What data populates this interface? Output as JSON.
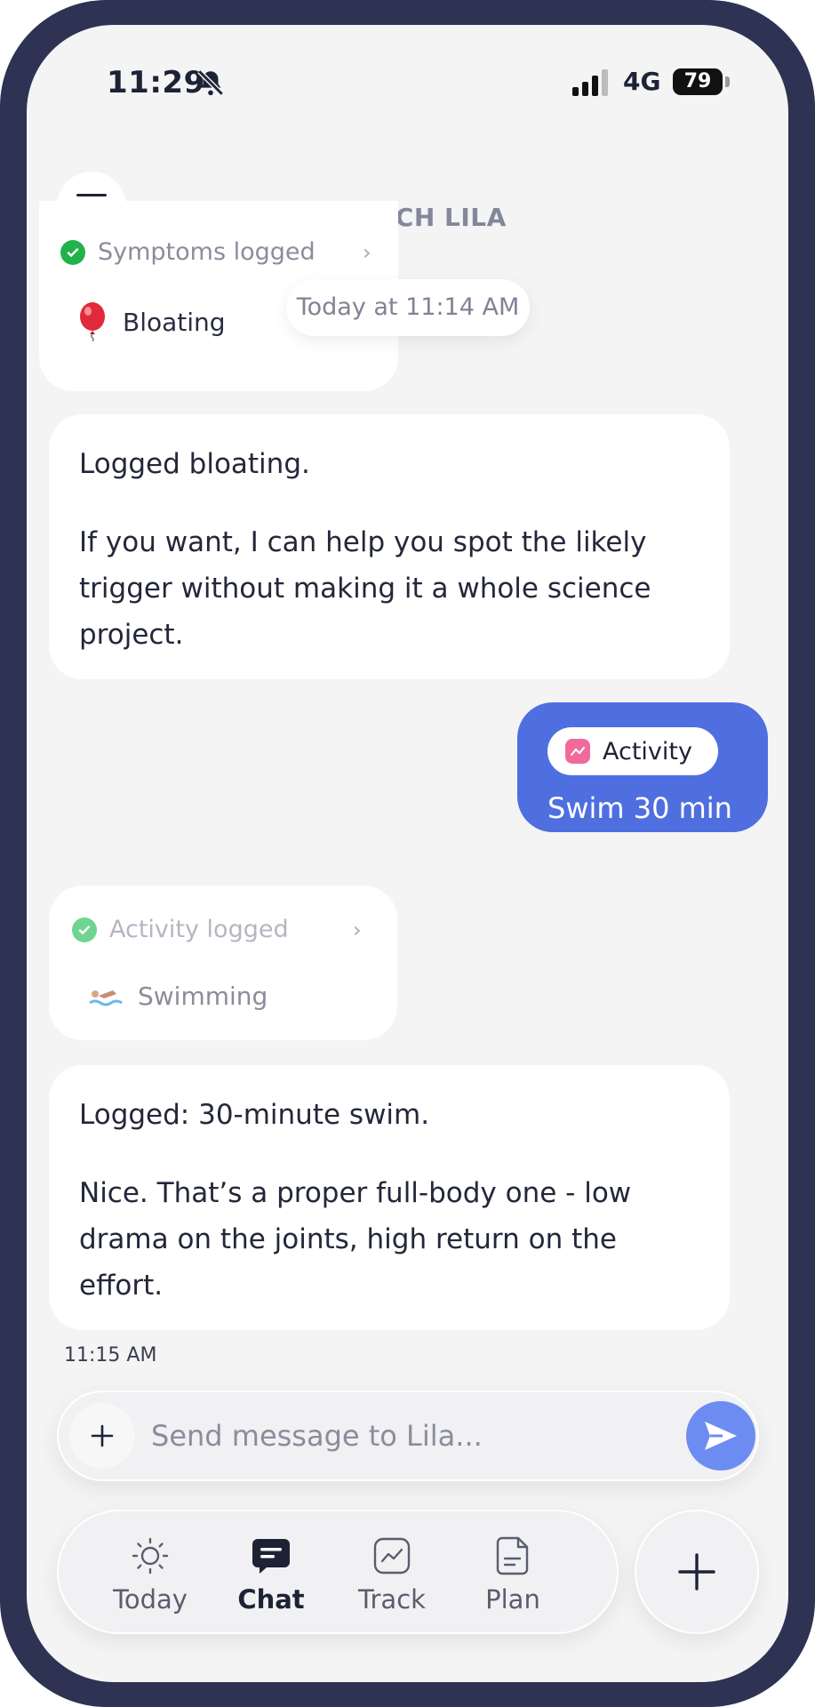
{
  "status_bar": {
    "time": "11:29",
    "network": "4G",
    "battery": "79",
    "icons": [
      "bell-slash-icon",
      "signal-bars-icon",
      "battery-icon"
    ]
  },
  "header": {
    "menu_icon": "hamburger-menu-icon",
    "title": "COACH LILA",
    "presence_color": "#8f86ef"
  },
  "chat": {
    "symptoms_card": {
      "heading": "Symptoms logged",
      "item": "Bloating",
      "item_icon": "balloon-icon"
    },
    "timestamp_pill": "Today at 11:14 AM",
    "coach_msg_1": {
      "p1": "Logged bloating.",
      "p2": "If you want, I can help you spot the likely trigger without making it a whole science project."
    },
    "user_msg": {
      "chip_label": "Activity",
      "text": "Swim 30 min",
      "bubble_color": "#4f6fe0"
    },
    "activity_card": {
      "heading": "Activity logged",
      "item": "Swimming",
      "item_icon": "swimmer-icon"
    },
    "coach_msg_2": {
      "p1": "Logged: 30-minute swim.",
      "p2": "Nice. That’s a proper full-body one - low drama on the joints, high return on the effort."
    },
    "last_time": "11:15 AM"
  },
  "composer": {
    "placeholder": "Send message to Lila...",
    "value": ""
  },
  "tabs": [
    {
      "label": "Today",
      "icon": "sun-icon"
    },
    {
      "label": "Chat",
      "icon": "chat-icon",
      "active": true
    },
    {
      "label": "Track",
      "icon": "chart-icon"
    },
    {
      "label": "Plan",
      "icon": "document-icon"
    }
  ]
}
